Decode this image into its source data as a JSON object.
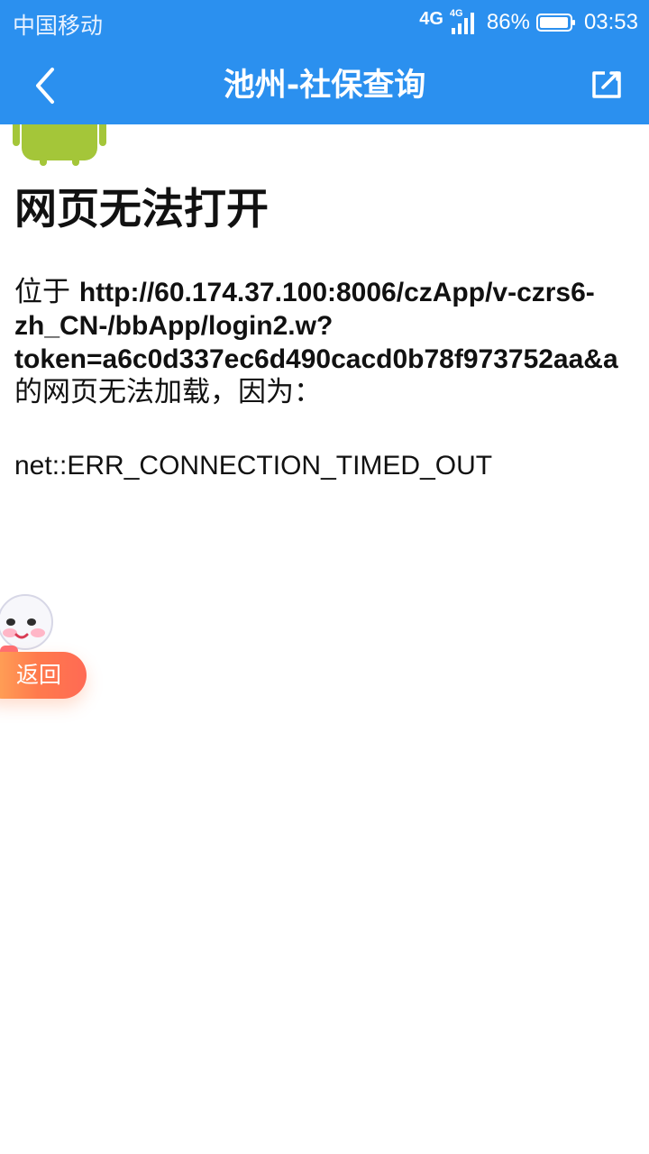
{
  "status_bar": {
    "carrier": "中国移动",
    "network_primary": "4G",
    "network_secondary": "4G",
    "battery_percent": "86%",
    "time": "03:53"
  },
  "app_bar": {
    "title": "池州-社保查询",
    "back_icon": "chevron-left-icon",
    "share_icon": "share-icon"
  },
  "page": {
    "error_title": "网页无法打开",
    "prefix": "位于",
    "url_lines": [
      "http://60.174.37.100:8006/czApp/v-czrs6-",
      "zh_CN-/bbApp/login2.w?",
      "token=a6c0d337ec6d490cacd0b78f973752aa&a"
    ],
    "suffix": "的网页无法加载，因为：",
    "error_code": "net::ERR_CONNECTION_TIMED_OUT"
  },
  "floating_button": {
    "label": "返回"
  },
  "colors": {
    "primary": "#2b90ef",
    "button_gradient_start": "#ffb15a",
    "button_gradient_end": "#ff6a54"
  }
}
